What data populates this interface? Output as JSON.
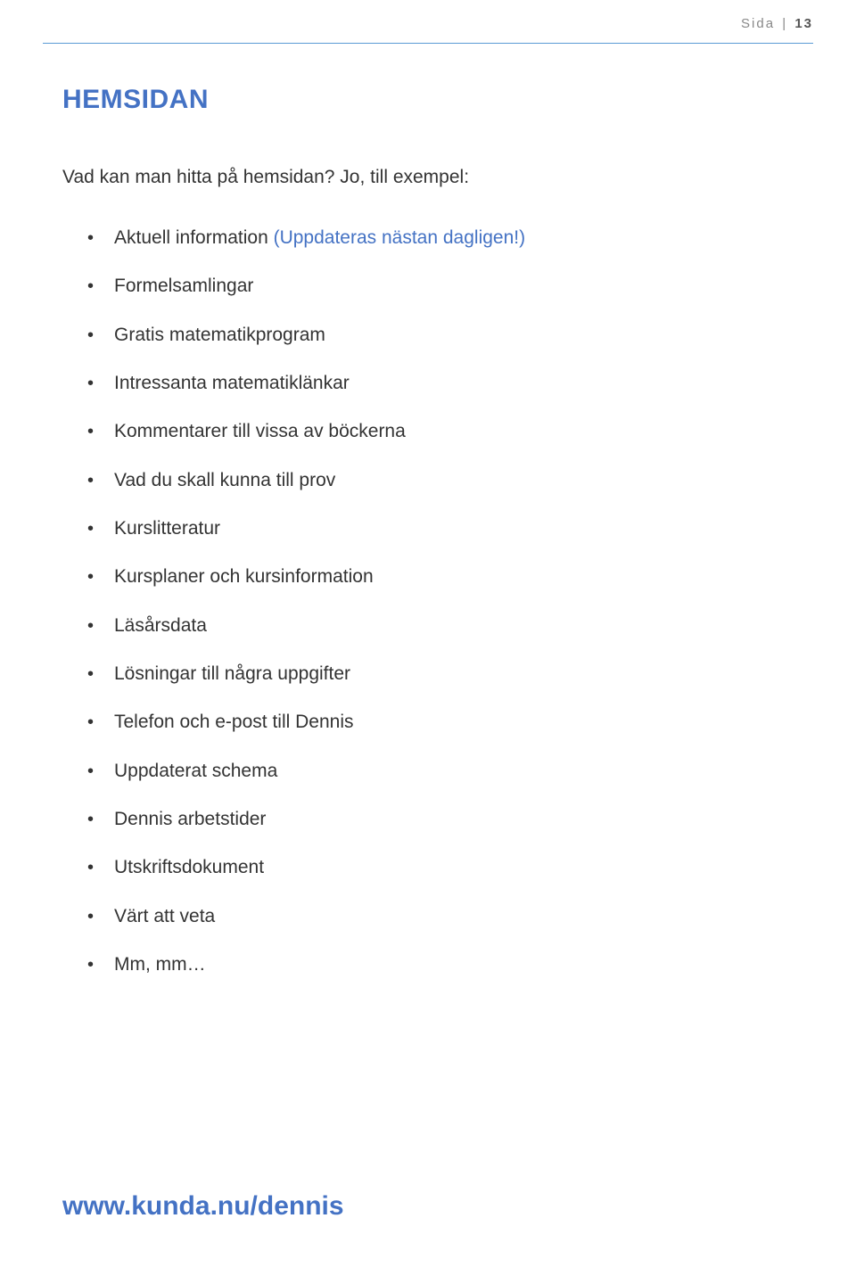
{
  "header": {
    "label": "Sida",
    "separator": "|",
    "page_number": "13"
  },
  "title": "HEMSIDAN",
  "intro": "Vad kan man hitta på hemsidan? Jo, till exempel:",
  "items": [
    {
      "text": "Aktuell information ",
      "note": "(Uppdateras nästan dagligen!)"
    },
    {
      "text": "Formelsamlingar"
    },
    {
      "text": "Gratis matematikprogram"
    },
    {
      "text": "Intressanta matematiklänkar"
    },
    {
      "text": "Kommentarer till vissa av böckerna"
    },
    {
      "text": "Vad du skall kunna till prov"
    },
    {
      "text": "Kurslitteratur"
    },
    {
      "text": "Kursplaner och kursinformation"
    },
    {
      "text": "Läsårsdata"
    },
    {
      "text": "Lösningar till några uppgifter"
    },
    {
      "text": "Telefon och e-post till Dennis"
    },
    {
      "text": "Uppdaterat schema"
    },
    {
      "text": "Dennis arbetstider"
    },
    {
      "text": "Utskriftsdokument"
    },
    {
      "text": "Värt att veta"
    },
    {
      "text": "Mm, mm…"
    }
  ],
  "footer_link": "www.kunda.nu/dennis"
}
